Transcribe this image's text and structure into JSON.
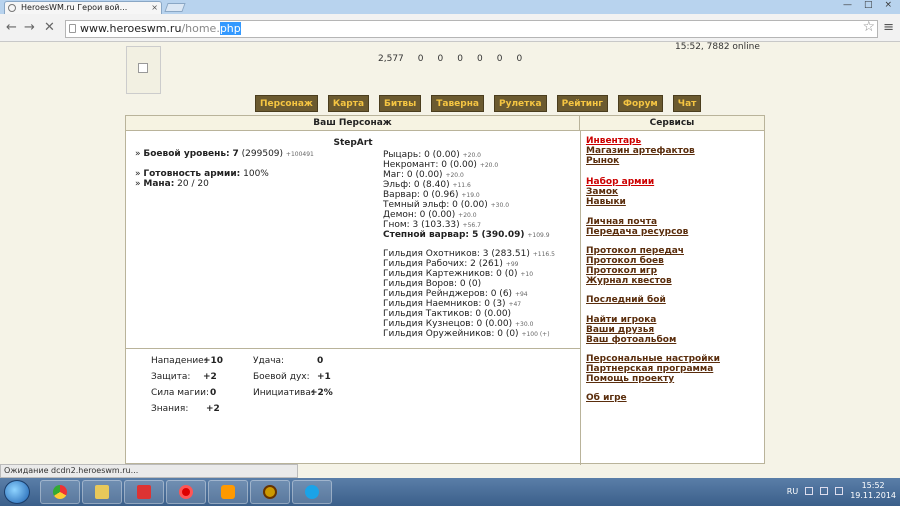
{
  "browser": {
    "tab_title": "HeroesWM.ru Герои вой...",
    "tab_close": "×",
    "url_host": "www.heroeswm.ru",
    "url_path": "/home.",
    "url_selected": "php",
    "window_buttons": [
      "—",
      "□",
      "×"
    ],
    "status": "Ожидание dcdn2.heroeswm.ru..."
  },
  "header": {
    "time_online": "15:52, 7882 online",
    "resources": [
      "2,577",
      "0",
      "0",
      "0",
      "0",
      "0",
      "0"
    ]
  },
  "nav": [
    "Персонаж",
    "Карта",
    "Битвы",
    "Таверна",
    "Рулетка",
    "Рейтинг",
    "Форум",
    "Чат"
  ],
  "panel": {
    "left_title": "Ваш Персонаж",
    "right_title": "Сервисы",
    "hero_name": "StepArt",
    "combat_level_label": "Боевой уровень:",
    "combat_level": "7",
    "combat_exp": "(299509)",
    "combat_exp_delta": "+100491",
    "army_label": "Готовность армии:",
    "army_value": "100%",
    "mana_label": "Мана:",
    "mana_value": "20 / 20"
  },
  "factions": [
    {
      "name": "Рыцарь: 0 (0.00)",
      "delta": "+20.0"
    },
    {
      "name": "Некромант: 0 (0.00)",
      "delta": "+20.0"
    },
    {
      "name": "Маг: 0 (0.00)",
      "delta": "+20.0"
    },
    {
      "name": "Эльф: 0 (8.40)",
      "delta": "+11.6"
    },
    {
      "name": "Варвар: 0 (0.96)",
      "delta": "+19.0"
    },
    {
      "name": "Темный эльф: 0 (0.00)",
      "delta": "+30.0"
    },
    {
      "name": "Демон: 0 (0.00)",
      "delta": "+20.0"
    },
    {
      "name": "Гном: 3 (103.33)",
      "delta": "+56.7"
    },
    {
      "name": "Степной варвар: 5 (390.09)",
      "delta": "+109.9",
      "bold": true
    }
  ],
  "guilds": [
    {
      "name": "Гильдия Охотников: 3 (283.51)",
      "delta": "+116.5"
    },
    {
      "name": "Гильдия Рабочих: 2 (261)",
      "delta": "+99"
    },
    {
      "name": "Гильдия Картежников: 0 (0)",
      "delta": "+10"
    },
    {
      "name": "Гильдия Воров: 0 (0)",
      "delta": ""
    },
    {
      "name": "Гильдия Рейнджеров: 0 (6)",
      "delta": "+94"
    },
    {
      "name": "Гильдия Наемников: 0 (3)",
      "delta": "+47"
    },
    {
      "name": "Гильдия Тактиков: 0 (0.00)",
      "delta": ""
    },
    {
      "name": "Гильдия Кузнецов: 0 (0.00)",
      "delta": "+30.0"
    },
    {
      "name": "Гильдия Оружейников: 0 (0)",
      "delta": "+100 (+)"
    }
  ],
  "attributes": [
    {
      "label": "Нападение:",
      "value": "+10"
    },
    {
      "label": "Удача:",
      "value": "0"
    },
    {
      "label": "Защита:",
      "value": "+2"
    },
    {
      "label": "Боевой дух:",
      "value": "+1"
    },
    {
      "label": "Сила магии:",
      "value": "0"
    },
    {
      "label": "Инициатива:",
      "value": "+2%"
    },
    {
      "label": "Знания:",
      "value": "+2"
    }
  ],
  "services": [
    {
      "label": "Инвентарь",
      "red": true
    },
    {
      "label": "Магазин артефактов"
    },
    {
      "label": "Рынок"
    },
    {
      "label": "Набор армии",
      "red": true
    },
    {
      "label": "Замок"
    },
    {
      "label": "Навыки"
    },
    {
      "label": "Личная почта"
    },
    {
      "label": "Передача ресурсов"
    },
    {
      "label": "Протокол передач"
    },
    {
      "label": "Протокол боев"
    },
    {
      "label": "Протокол игр"
    },
    {
      "label": "Журнал квестов"
    },
    {
      "label": "Последний бой"
    },
    {
      "label": "Найти игрока"
    },
    {
      "label": "Ваши друзья"
    },
    {
      "label": "Ваш фотоальбом"
    },
    {
      "label": "Персональные настройки"
    },
    {
      "label": "Партнерская программа"
    },
    {
      "label": "Помощь проекту"
    },
    {
      "label": "Об игре"
    }
  ],
  "taskbar": {
    "lang": "RU",
    "time": "15:52",
    "date": "19.11.2014"
  }
}
